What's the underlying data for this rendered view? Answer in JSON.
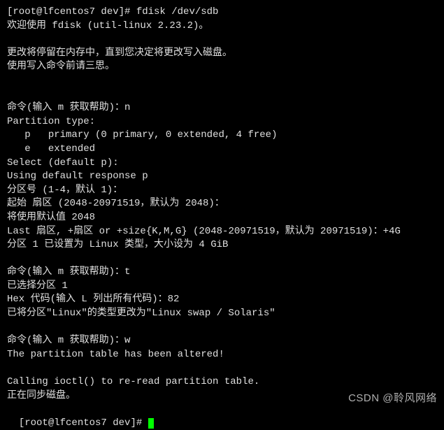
{
  "terminal": {
    "lines": [
      "[root@lfcentos7 dev]# fdisk /dev/sdb",
      "欢迎使用 fdisk (util-linux 2.23.2)。",
      "",
      "更改将停留在内存中，直到您决定将更改写入磁盘。",
      "使用写入命令前请三思。",
      "",
      "",
      "命令(输入 m 获取帮助)：n",
      "Partition type:",
      "   p   primary (0 primary, 0 extended, 4 free)",
      "   e   extended",
      "Select (default p):",
      "Using default response p",
      "分区号 (1-4，默认 1)：",
      "起始 扇区 (2048-20971519，默认为 2048)：",
      "将使用默认值 2048",
      "Last 扇区, +扇区 or +size{K,M,G} (2048-20971519，默认为 20971519)：+4G",
      "分区 1 已设置为 Linux 类型，大小设为 4 GiB",
      "",
      "命令(输入 m 获取帮助)：t",
      "已选择分区 1",
      "Hex 代码(输入 L 列出所有代码)：82",
      "已将分区\"Linux\"的类型更改为\"Linux swap / Solaris\"",
      "",
      "命令(输入 m 获取帮助)：w",
      "The partition table has been altered!",
      "",
      "Calling ioctl() to re-read partition table.",
      "正在同步磁盘。"
    ],
    "final_prompt": "[root@lfcentos7 dev]# "
  },
  "watermark": "CSDN @聆风网络"
}
